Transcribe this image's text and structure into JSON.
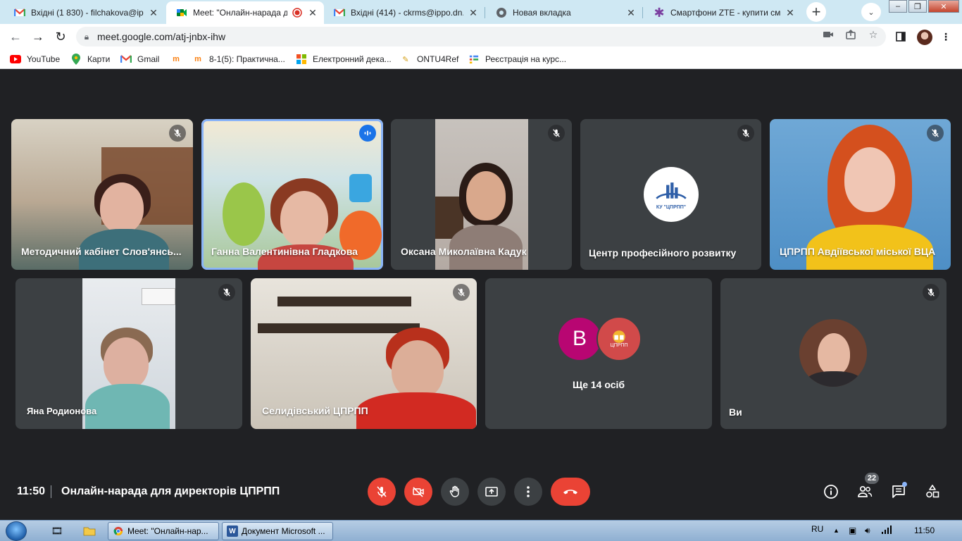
{
  "browser": {
    "tabs": [
      {
        "label": "Вхідні (1 830) - filchakova@ippo",
        "icon": "gmail-icon",
        "active": false
      },
      {
        "label": "Meet: \"Онлайн-нарада дл",
        "icon": "meet-icon",
        "active": true
      },
      {
        "label": "Вхідні (414) - ckrms@ippo.dn.",
        "icon": "gmail-icon",
        "active": false
      },
      {
        "label": "Новая вкладка",
        "icon": "chrome-icon",
        "active": false
      },
      {
        "label": "Смартфони ZTE - купити смар",
        "icon": "asterisk-icon",
        "active": false
      }
    ],
    "url": "meet.google.com/atj-jnbx-ihw",
    "bookmarks": [
      {
        "label": "YouTube",
        "icon": "youtube-icon"
      },
      {
        "label": "Карти",
        "icon": "maps-icon"
      },
      {
        "label": "Gmail",
        "icon": "gmail-icon"
      },
      {
        "label": "",
        "icon": "moodle-icon"
      },
      {
        "label": "8-1(5): Практична...",
        "icon": "moodle-icon"
      },
      {
        "label": "Електронний дека...",
        "icon": "windows-icon"
      },
      {
        "label": "ONTU4Ref",
        "icon": "pencil-icon"
      },
      {
        "label": "Реєстрація на курс...",
        "icon": "forms-icon"
      }
    ]
  },
  "meet": {
    "participants": [
      {
        "name": "Методичний кабінет Слов'янсь...",
        "muted": true
      },
      {
        "name": "Ганна Валентинівна Гладкова",
        "speaking": true
      },
      {
        "name": "Оксана Миколаївна Кадук",
        "muted": true
      },
      {
        "name": "Центр професійного розвитку",
        "muted": true,
        "logo_text": "КУ \"ЦПРПП\""
      },
      {
        "name": "ЦПРПП Авдіївської міської ВЦА",
        "muted": true
      },
      {
        "name": "Яна Родионова",
        "muted": true
      },
      {
        "name": "Селидівський ЦПРПП",
        "muted": true
      },
      {
        "name": "Ще 14 осіб",
        "avatar_letter": "В",
        "logo_text": "ЦПРПП"
      },
      {
        "name": "Ви",
        "muted": true
      }
    ],
    "clock": "11:50",
    "title": "Онлайн-нарада для директорів ЦПРПП",
    "people_count": "22"
  },
  "taskbar": {
    "tasks": [
      {
        "label": "Meet: \"Онлайн-нар...",
        "icon": "chrome-icon"
      },
      {
        "label": "Документ Microsoft ...",
        "icon": "word-icon"
      }
    ],
    "language": "RU",
    "time": "11:50"
  },
  "colors": {
    "meet_background": "#202124",
    "tile_background": "#3c4043",
    "end_call_red": "#ea4335",
    "speaking_outline": "#8ab4f8",
    "tabstrip": "#cfe8f3"
  }
}
